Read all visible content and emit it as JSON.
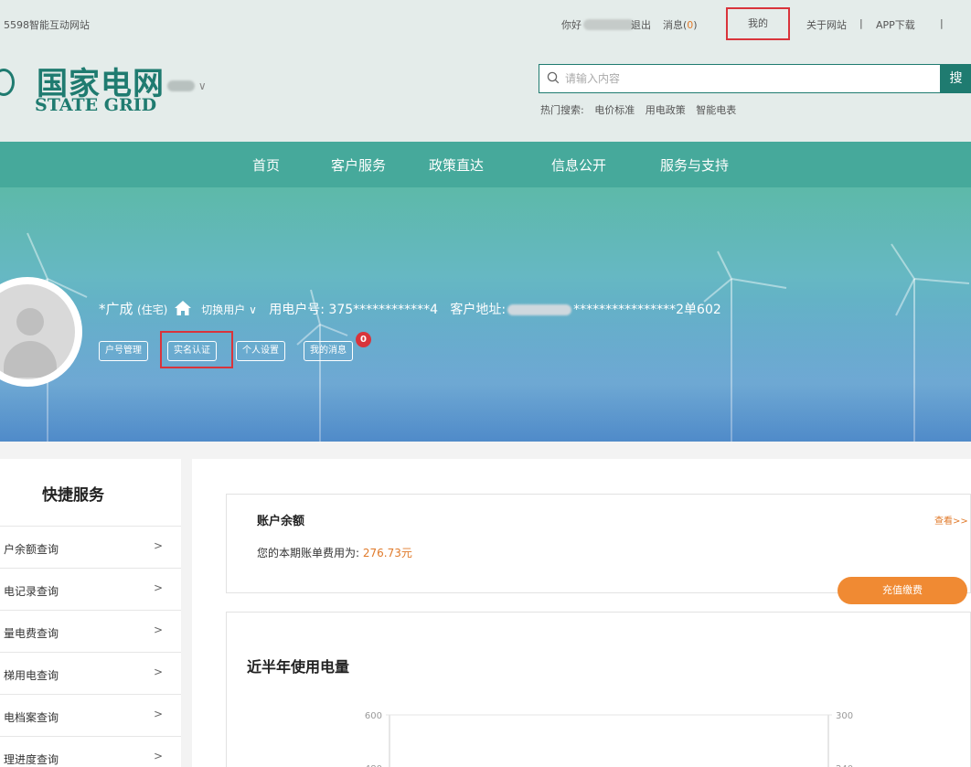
{
  "topbar": {
    "site": "5598智能互动网站",
    "greeting": "你好",
    "logout": "退出",
    "messages_prefix": "消息(",
    "messages_count": "0",
    "messages_suffix": ")",
    "mine": "我的",
    "about": "关于网站",
    "separator": "|",
    "app_download": "APP下载"
  },
  "header": {
    "logo_cn": "国家电网",
    "logo_en": "STATE GRID",
    "region_chevron": "∨",
    "search_placeholder": "请输入内容",
    "search_button": "搜",
    "hot_label": "热门搜索:",
    "hot_items": [
      "电价标准",
      "用电政策",
      "智能电表"
    ]
  },
  "nav": {
    "items": [
      "首页",
      "客户服务",
      "政策直达",
      "信息公开",
      "服务与支持"
    ]
  },
  "user": {
    "name": "*广成",
    "type": "(住宅)",
    "switch_user": "切换用户",
    "switch_chevron": "∨",
    "account_label": "用电户号:",
    "account_no": "375************4",
    "address_label": "客户地址:",
    "address_tail": "****************2单602",
    "buttons": [
      "户号管理",
      "实名认证",
      "个人设置",
      "我的消息"
    ],
    "message_badge": "0"
  },
  "sidebar": {
    "title": "快捷服务",
    "items": [
      {
        "label": "户余额查询"
      },
      {
        "label": "电记录查询"
      },
      {
        "label": "量电费查询"
      },
      {
        "label": "梯用电查询"
      },
      {
        "label": "电档案查询"
      },
      {
        "label": "理进度查询"
      }
    ],
    "chevron": ">"
  },
  "balance": {
    "title": "账户余额",
    "more": "查看>>",
    "bill_label": "您的本期账单费用为:",
    "bill_amount": "276.73元",
    "pay_button": "充值缴费"
  },
  "usage": {
    "title": "近半年使用电量"
  },
  "chart_data": {
    "type": "line",
    "title": "近半年使用电量",
    "y_left_ticks": [
      "600",
      "480"
    ],
    "y_right_ticks": [
      "300",
      "240"
    ]
  },
  "colors": {
    "brand": "#1f7b70",
    "nav": "#46a99b",
    "accent": "#f08a33",
    "highlight": "#d9343b"
  }
}
